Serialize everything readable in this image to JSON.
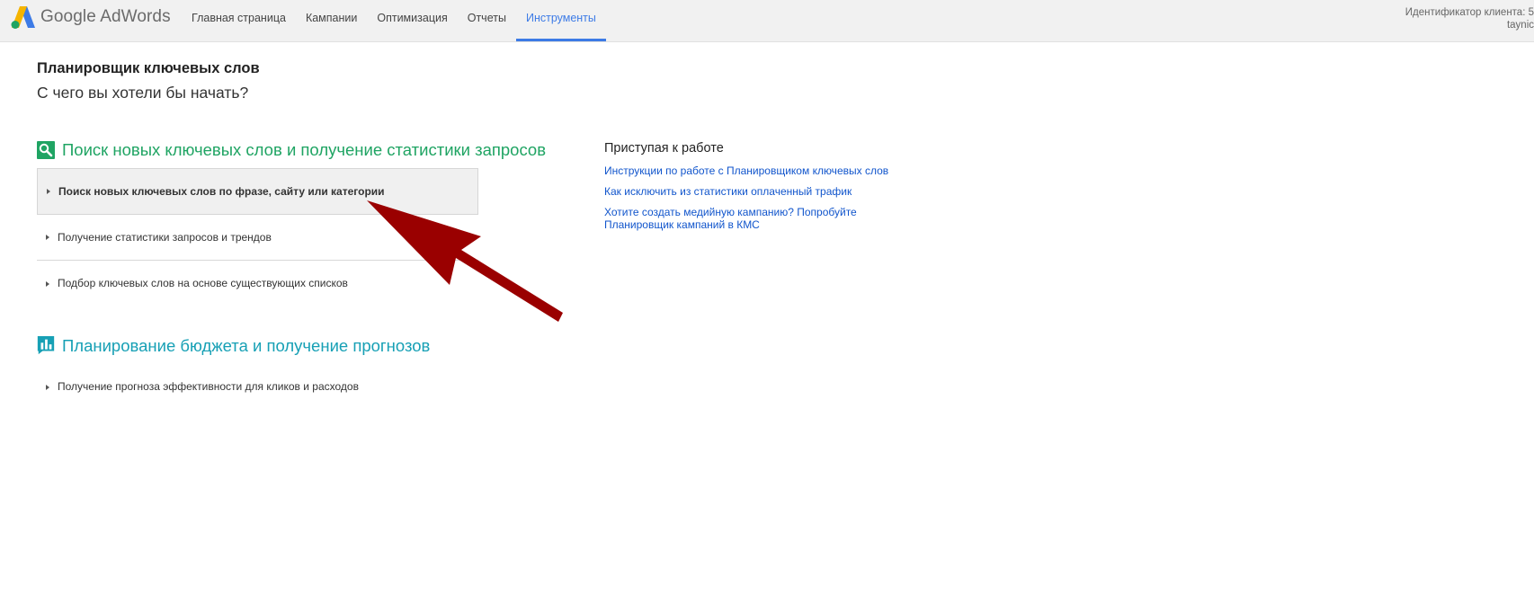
{
  "header": {
    "brand": "Google AdWords",
    "nav": [
      {
        "label": "Главная страница"
      },
      {
        "label": "Кампании"
      },
      {
        "label": "Оптимизация"
      },
      {
        "label": "Отчеты"
      },
      {
        "label": "Инструменты",
        "active": true
      }
    ],
    "client_id_label": "Идентификатор клиента: 5",
    "account": "taynic"
  },
  "page": {
    "title": "Планировщик ключевых слов",
    "subtitle": "С чего вы хотели бы начать?"
  },
  "section_search": {
    "heading": "Поиск новых ключевых слов и получение статистики запросов",
    "icon": "search-icon",
    "options": [
      {
        "label": "Поиск новых ключевых слов по фразе, сайту или категории",
        "selected": true
      },
      {
        "label": "Получение статистики запросов и трендов"
      },
      {
        "label": "Подбор ключевых слов на основе существующих списков"
      }
    ]
  },
  "section_budget": {
    "heading": "Планирование бюджета и получение прогнозов",
    "icon": "bar-chart-icon",
    "options": [
      {
        "label": "Получение прогноза эффективности для кликов и расходов"
      }
    ]
  },
  "getting_started": {
    "title": "Приступая к работе",
    "links": [
      {
        "label": "Инструкции по работе с Планировщиком ключевых слов"
      },
      {
        "label": "Как исключить из статистики оплаченный трафик"
      },
      {
        "label": "Хотите создать медийную кампанию? Попробуйте Планировщик кампаний в КМС"
      }
    ]
  },
  "colors": {
    "accent_blue": "#3d7be6",
    "search_green": "#1fa463",
    "budget_teal": "#17a0b5",
    "link_blue": "#1155cc",
    "arrow_red": "#9a0000"
  }
}
